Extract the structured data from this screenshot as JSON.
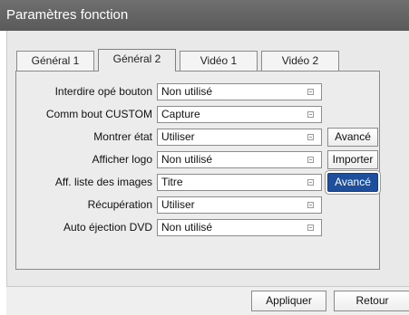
{
  "window": {
    "title": "Paramètres fonction"
  },
  "tabs": [
    {
      "label": "Général 1",
      "active": false
    },
    {
      "label": "Général 2",
      "active": true
    },
    {
      "label": "Vidéo 1",
      "active": false
    },
    {
      "label": "Vidéo 2",
      "active": false
    }
  ],
  "settings": [
    {
      "label": "Interdire opé bouton",
      "value": "Non utilisé"
    },
    {
      "label": "Comm bout CUSTOM",
      "value": "Capture"
    },
    {
      "label": "Montrer état",
      "value": "Utiliser",
      "button": "Avancé"
    },
    {
      "label": "Afficher logo",
      "value": "Non utilisé",
      "button": "Importer"
    },
    {
      "label": "Aff. liste des images",
      "value": "Titre",
      "button": "Avancé",
      "button_focused": true
    },
    {
      "label": "Récupération",
      "value": "Utiliser"
    },
    {
      "label": "Auto éjection DVD",
      "value": "Non utilisé"
    }
  ],
  "footer": {
    "apply_label": "Appliquer",
    "back_label": "Retour"
  },
  "colors": {
    "titlebar": "#5f5f5f",
    "focused_button": "#1d4f9e",
    "content_bg": "#e9e9e9"
  }
}
